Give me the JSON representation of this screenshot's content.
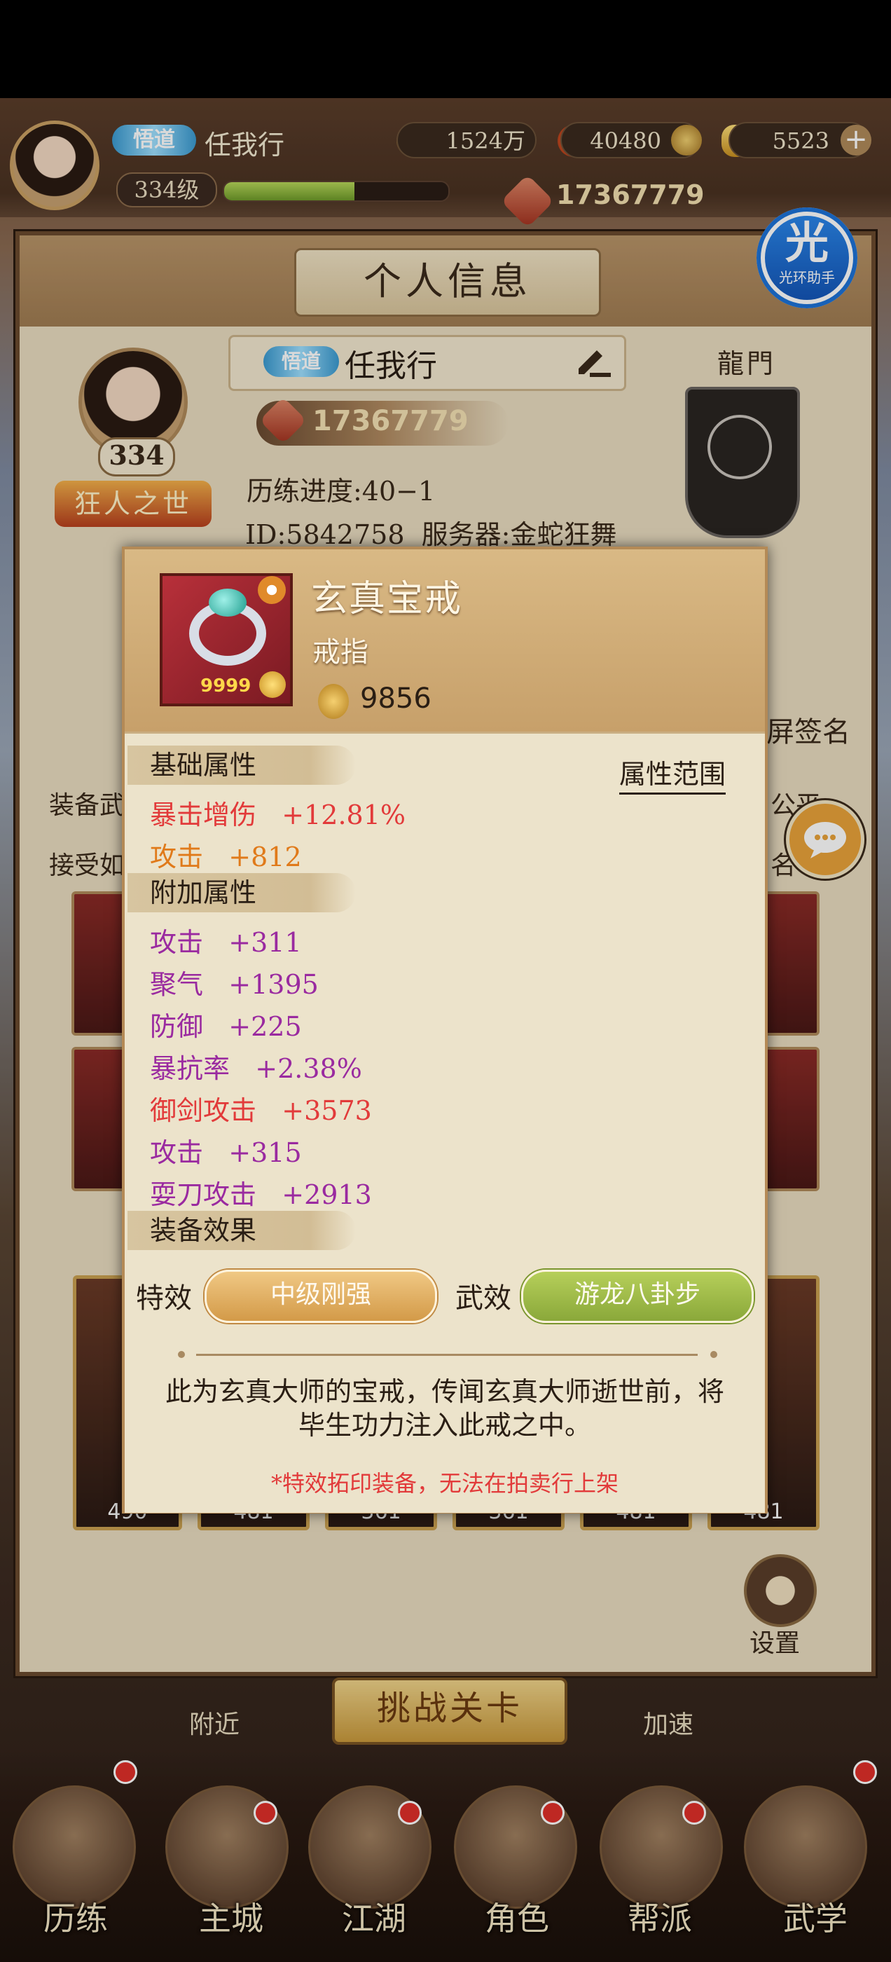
{
  "top_bar": {
    "vip_tag": "悟道",
    "player_name": "任我行",
    "level": "334级",
    "xp_fraction": 0.58,
    "copper": "1524万",
    "medal": "40480",
    "ingot": "5523",
    "power": "17367779"
  },
  "helper": {
    "label": "光环助手",
    "glyph": "光"
  },
  "panel": {
    "title": "个人信息",
    "avatar_level": "334",
    "title_badge": "狂人之世",
    "vip_tag": "悟道",
    "name": "任我行",
    "power": "17367779",
    "progress": "历练进度:40−1",
    "id_server": "ID:5842758  服务器:金蛇狂舞",
    "guild": "龍門",
    "left_row1": "装备武",
    "left_row2": "接受如",
    "right_row1": "公平",
    "right_row2": "名",
    "sign_label": "屏签名",
    "card_values": [
      "490",
      "481",
      "361",
      "361",
      "481",
      "481"
    ],
    "settings_label": "设置"
  },
  "popup": {
    "item_name": "玄真宝戒",
    "item_type": "戒指",
    "item_qty": "9999",
    "score": "9856",
    "base_section": "基础属性",
    "range_link": "属性范围",
    "base_attrs": [
      {
        "name": "暴击增伤",
        "value": "+12.81%"
      },
      {
        "name": "攻击",
        "value": "+812"
      }
    ],
    "extra_section": "附加属性",
    "extra_attrs": [
      {
        "name": "攻击",
        "value": "+311"
      },
      {
        "name": "聚气",
        "value": "+1395"
      },
      {
        "name": "防御",
        "value": "+225"
      },
      {
        "name": "暴抗率",
        "value": "+2.38%"
      },
      {
        "name": "御剑攻击",
        "value": "+3573"
      },
      {
        "name": "攻击",
        "value": "+315"
      },
      {
        "name": "耍刀攻击",
        "value": "+2913"
      }
    ],
    "effect_section": "装备效果",
    "special_label": "特效",
    "special_value": "中级刚强",
    "martial_label": "武效",
    "martial_value": "游龙八卦步",
    "description": "此为玄真大师的宝戒，传闻玄真大师逝世前，将毕生功力注入此戒之中。",
    "warning": "*特效拓印装备，无法在拍卖行上架"
  },
  "bottom": {
    "challenge": "挑战关卡",
    "nearby": "附近",
    "speedup": "加速",
    "nav": [
      "历练",
      "主城",
      "江湖",
      "角色",
      "帮派",
      "武学"
    ]
  }
}
